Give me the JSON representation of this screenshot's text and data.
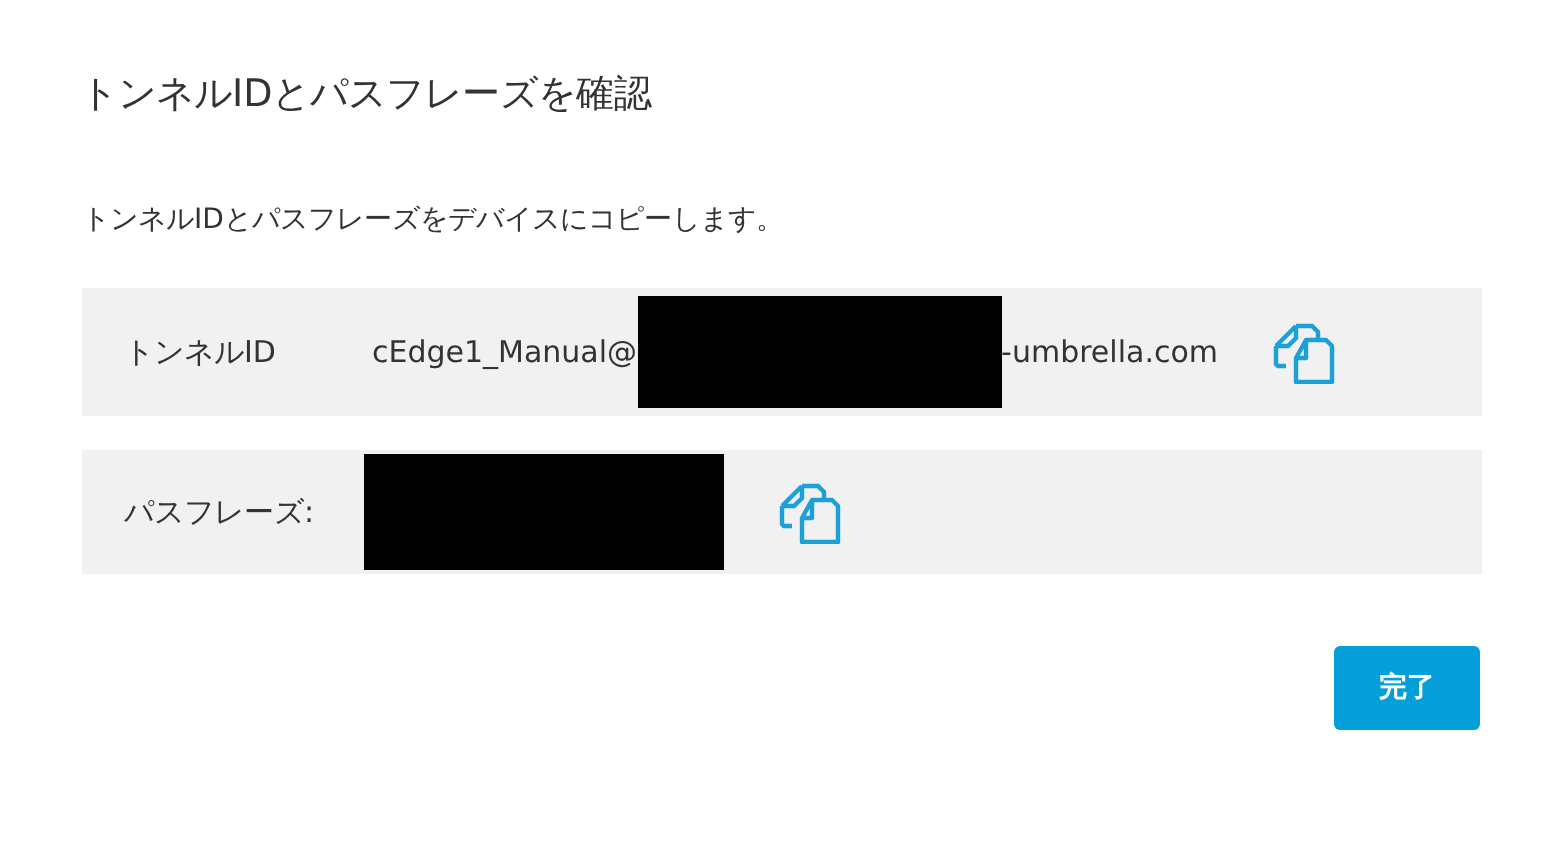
{
  "dialog": {
    "title": "トンネルIDとパスフレーズを確認",
    "description": "トンネルIDとパスフレーズをデバイスにコピーします。"
  },
  "fields": [
    {
      "label": "トンネルID",
      "value_start": "cEdge1_Manual@",
      "redacted": true,
      "value_end": "-umbrella.com"
    },
    {
      "label": "パスフレーズ:",
      "redacted": true
    }
  ],
  "buttons": [
    "完了"
  ]
}
